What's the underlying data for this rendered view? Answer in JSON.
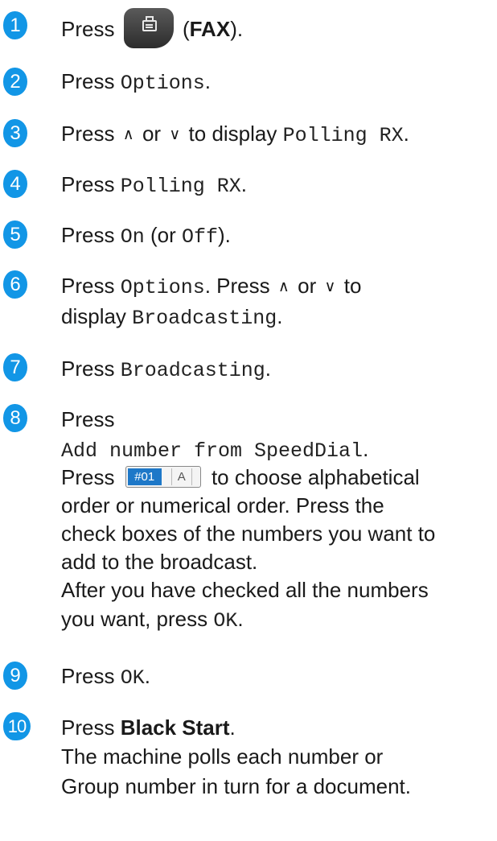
{
  "steps": [
    {
      "num": "1",
      "press": "Press",
      "btn_label": "(",
      "btn_bold": "FAX",
      "tail": ")."
    },
    {
      "num": "2",
      "press": "Press",
      "code": "Options",
      "tail": "."
    },
    {
      "num": "3",
      "press": "Press",
      "up": "∧",
      "or": "or",
      "down": "∨",
      "mid": "to display",
      "code": "Polling RX",
      "tail": "."
    },
    {
      "num": "4",
      "press": "Press",
      "code": "Polling RX",
      "tail": "."
    },
    {
      "num": "5",
      "press": "Press",
      "code_on": "On",
      "or_open": "(or",
      "code_off": "Off",
      "tail": ")."
    },
    {
      "num": "6",
      "press": "Press",
      "code": "Options",
      "mid": ". Press",
      "up": "∧",
      "or": "or",
      "down": "∨",
      "to": "to",
      "line2_pre": "display",
      "line2_code": "Broadcasting",
      "tail": "."
    },
    {
      "num": "7",
      "press": "Press",
      "code": "Broadcasting",
      "tail": "."
    },
    {
      "num": "8",
      "press": "Press",
      "code": "Add number from SpeedDial",
      "tail": ".",
      "l3_pre": "Press",
      "l3_post": "to choose alphabetical",
      "l4": "order or numerical order. Press the",
      "l5": "check boxes of the numbers you want to",
      "l6": "add to the broadcast.",
      "l7": "After you have checked all the numbers",
      "l8_pre": "you want, press",
      "l8_code": "OK",
      "l8_tail": ".",
      "sd_num": "#01",
      "sd_alpha": "A"
    },
    {
      "num": "9",
      "press": "Press",
      "code": "OK",
      "tail": "."
    },
    {
      "num": "10",
      "press": "Press",
      "bold": "Black Start",
      "tail": ".",
      "l2": "The machine polls each number or",
      "l3": "Group number in turn for a document."
    }
  ]
}
